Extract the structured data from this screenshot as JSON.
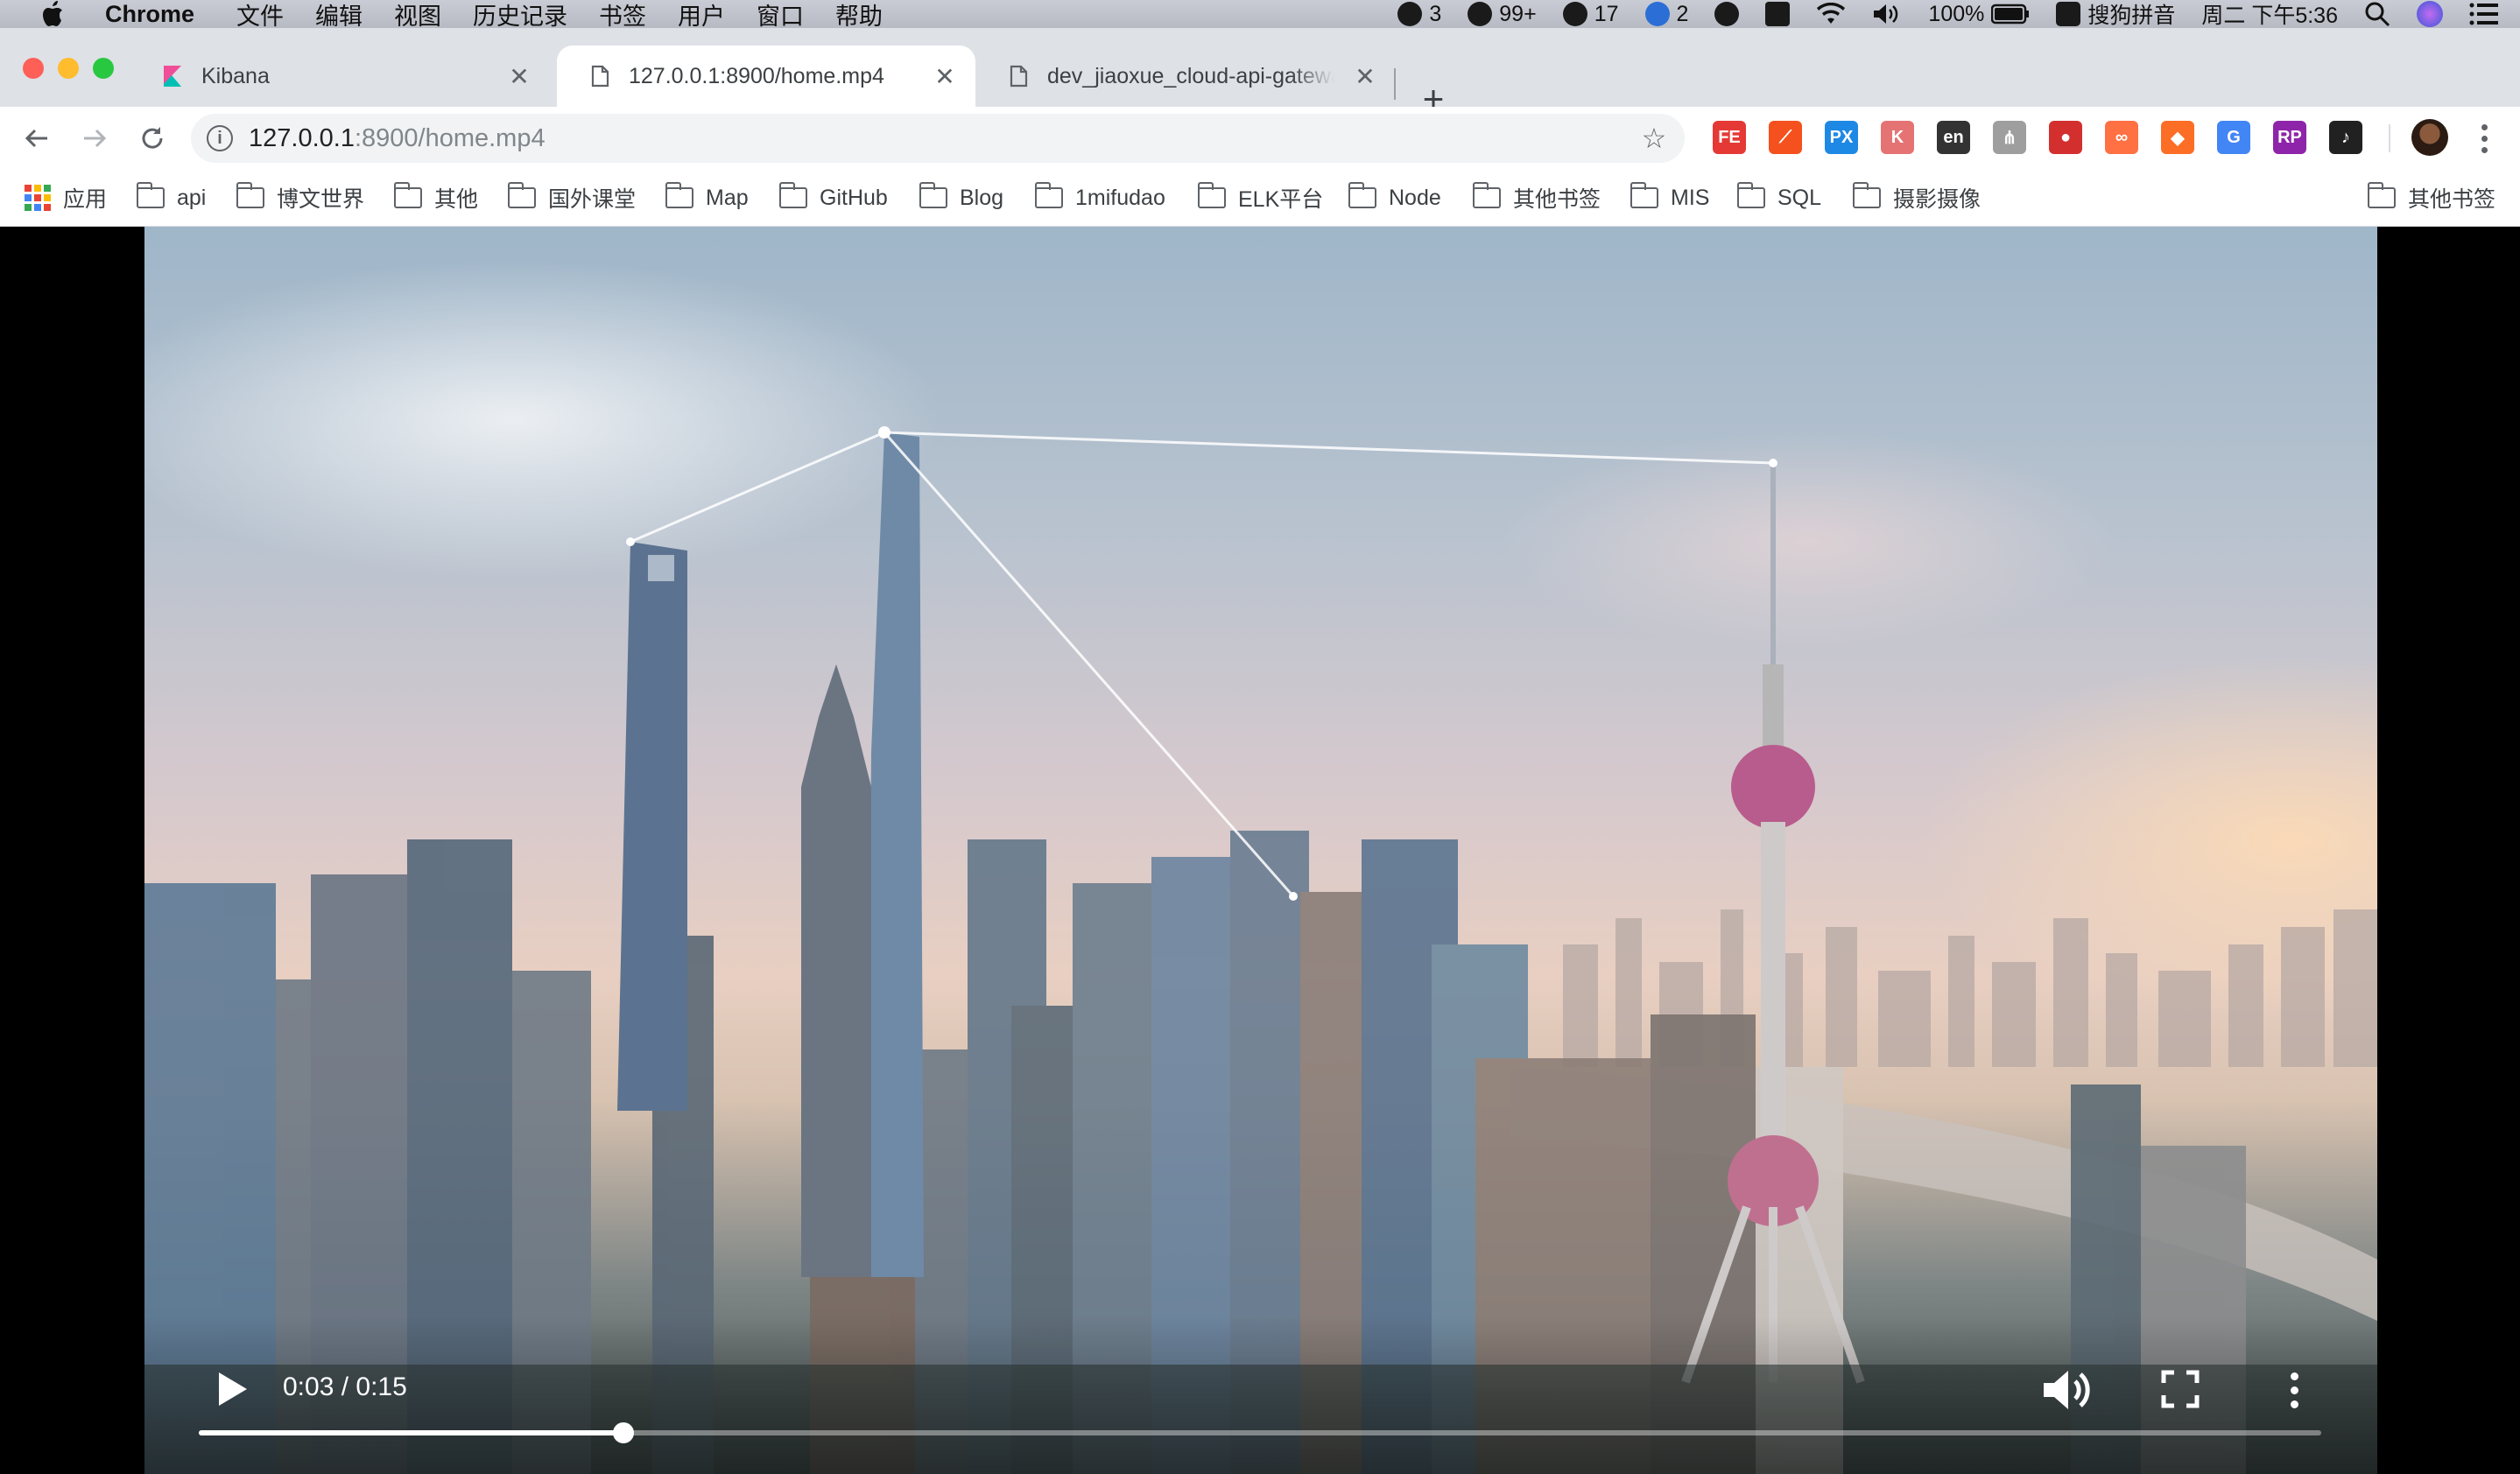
{
  "menubar": {
    "app_name": "Chrome",
    "menus": [
      "文件",
      "编辑",
      "视图",
      "历史记录",
      "书签",
      "用户",
      "窗口",
      "帮助"
    ],
    "status": {
      "wechat_count": "3",
      "qq_count": "99+",
      "app3_count": "17",
      "app4_count": "2",
      "battery": "100%",
      "input_method": "搜狗拼音",
      "clock": "周二 下午5:36"
    }
  },
  "tabs": [
    {
      "title": "Kibana",
      "active": false
    },
    {
      "title": "127.0.0.1:8900/home.mp4",
      "active": true
    },
    {
      "title": "dev_jiaoxue_cloud-api-gateway",
      "active": false
    }
  ],
  "omnibox": {
    "host": "127.0.0.1",
    "rest": ":8900/home.mp4"
  },
  "extensions": [
    {
      "label": "FE",
      "color": "#e53935"
    },
    {
      "label": "⟋",
      "color": "#f4511e"
    },
    {
      "label": "PX",
      "color": "#1e88e5"
    },
    {
      "label": "K",
      "color": "#e57373"
    },
    {
      "label": "en",
      "color": "#333333"
    },
    {
      "label": "⋔",
      "color": "#9e9e9e"
    },
    {
      "label": "●",
      "color": "#d32f2f"
    },
    {
      "label": "∞",
      "color": "#ff7043"
    },
    {
      "label": "◆",
      "color": "#fc6d26"
    },
    {
      "label": "G",
      "color": "#4285f4"
    },
    {
      "label": "RP",
      "color": "#8e24aa"
    },
    {
      "label": "♪",
      "color": "#212121"
    }
  ],
  "bookmarks": {
    "apps_label": "应用",
    "items": [
      "api",
      "博文世界",
      "其他",
      "国外课堂",
      "Map",
      "GitHub",
      "Blog",
      "1mifudao",
      "ELK平台",
      "Node",
      "其他书签",
      "MIS",
      "SQL",
      "摄影摄像"
    ],
    "other_bookmarks": "其他书签"
  },
  "video": {
    "current_time": "0:03",
    "duration": "0:15",
    "time_display": "0:03 / 0:15",
    "progress_percent": 20
  }
}
